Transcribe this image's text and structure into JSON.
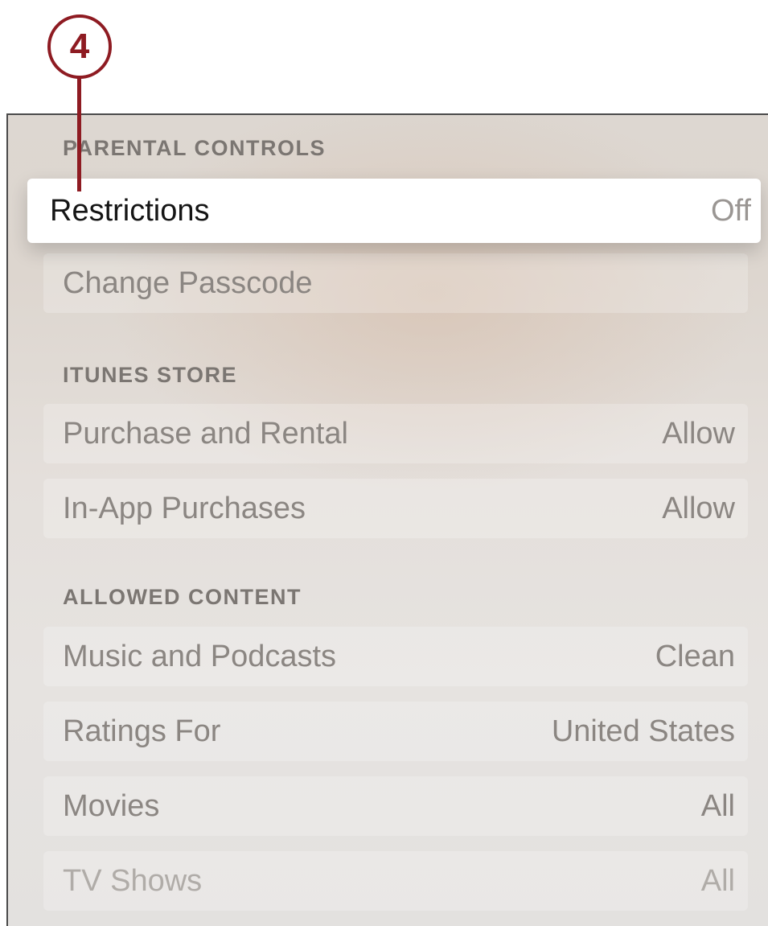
{
  "callout": {
    "number": "4",
    "color": "#8e1b22"
  },
  "sections": {
    "parental_controls": {
      "header": "PARENTAL CONTROLS",
      "items": [
        {
          "label": "Restrictions",
          "value": "Off",
          "focused": true
        },
        {
          "label": "Change Passcode",
          "value": ""
        }
      ]
    },
    "itunes_store": {
      "header": "ITUNES STORE",
      "items": [
        {
          "label": "Purchase and Rental",
          "value": "Allow"
        },
        {
          "label": "In-App Purchases",
          "value": "Allow"
        }
      ]
    },
    "allowed_content": {
      "header": "ALLOWED CONTENT",
      "items": [
        {
          "label": "Music and Podcasts",
          "value": "Clean"
        },
        {
          "label": "Ratings For",
          "value": "United States"
        },
        {
          "label": "Movies",
          "value": "All"
        },
        {
          "label": "TV Shows",
          "value": "All"
        }
      ]
    }
  }
}
